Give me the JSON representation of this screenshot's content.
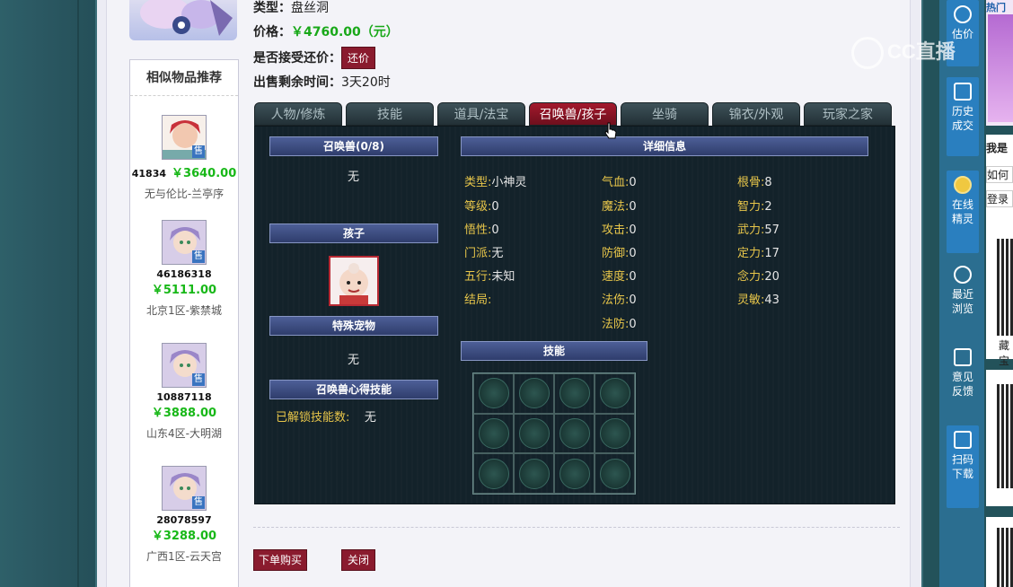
{
  "item_info": {
    "type_label": "类型：",
    "type_value": "盘丝洞",
    "price_label": "价格：",
    "price_value": "￥4760.00（元）",
    "counter_label": "是否接受还价：",
    "counter_button": "还价",
    "time_label": "出售剩余时间：",
    "time_value": "3天20时"
  },
  "similar": {
    "title": "相似物品推荐",
    "sold_tag": "售",
    "items": [
      {
        "id": "41834",
        "price": "￥3640.00",
        "server": "无与伦比-兰亭序"
      },
      {
        "id": "46186318",
        "price": "￥5111.00",
        "server": "北京1区-紫禁城"
      },
      {
        "id": "10887118",
        "price": "￥3888.00",
        "server": "山东4区-大明湖"
      },
      {
        "id": "28078597",
        "price": "￥3288.00",
        "server": "广西1区-云天宫"
      }
    ]
  },
  "tabs": [
    "人物/修炼",
    "技能",
    "道具/法宝",
    "召唤兽/孩子",
    "坐骑",
    "锦衣/外观",
    "玩家之家"
  ],
  "active_tab": "召唤兽/孩子",
  "panel": {
    "summon_header": "召唤兽(0/8)",
    "summon_none": "无",
    "child_header": "孩子",
    "special_header": "特殊宠物",
    "special_none": "无",
    "insight_header": "召唤兽心得技能",
    "unlocked_label": "已解锁技能数:",
    "unlocked_value": "无",
    "detail_header": "详细信息",
    "skills_header": "技能",
    "attrs_col1": [
      {
        "k": "类型:",
        "v": "小神灵"
      },
      {
        "k": "等级:",
        "v": "0"
      },
      {
        "k": "悟性:",
        "v": "0"
      },
      {
        "k": "门派:",
        "v": "无"
      },
      {
        "k": "五行:",
        "v": "未知"
      },
      {
        "k": "结局:",
        "v": ""
      }
    ],
    "attrs_col2": [
      {
        "k": "气血:",
        "v": "0"
      },
      {
        "k": "魔法:",
        "v": "0"
      },
      {
        "k": "攻击:",
        "v": "0"
      },
      {
        "k": "防御:",
        "v": "0"
      },
      {
        "k": "速度:",
        "v": "0"
      },
      {
        "k": "法伤:",
        "v": "0"
      },
      {
        "k": "法防:",
        "v": "0"
      }
    ],
    "attrs_col3": [
      {
        "k": "根骨:",
        "v": "8"
      },
      {
        "k": "智力:",
        "v": "2"
      },
      {
        "k": "武力:",
        "v": "57"
      },
      {
        "k": "定力:",
        "v": "17"
      },
      {
        "k": "念力:",
        "v": "20"
      },
      {
        "k": "灵敏:",
        "v": "43"
      }
    ]
  },
  "buttons": {
    "buy": "下单购买",
    "close": "关闭"
  },
  "sidebar": {
    "items": [
      "估价",
      "历史\n成交",
      "在线\n精灵",
      "最近\n浏览",
      "意见\n反馈",
      "扫码\n下载"
    ]
  },
  "right_edge": {
    "hot_label": "热门",
    "login_label": "我是",
    "how_label": "如何",
    "login2_label": "登录",
    "fav_label": "藏宝"
  },
  "watermark": "CC直播"
}
